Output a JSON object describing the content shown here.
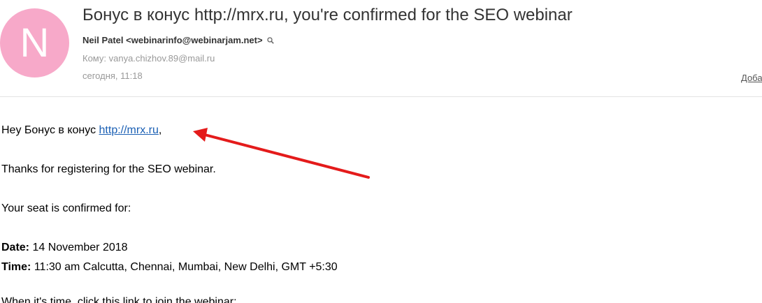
{
  "email": {
    "avatar_letter": "N",
    "avatar_color": "#f7a9c9",
    "subject": "Бонус в конус http://mrx.ru, you're confirmed for the SEO webinar",
    "sender": "Neil Patel <webinarinfo@webinarjam.net>",
    "recipient": "Кому: vanya.chizhov.89@mail.ru",
    "date": "сегодня, 11:18",
    "add_link": "Доба"
  },
  "body": {
    "greeting_prefix": "Hey Бонус в конус ",
    "greeting_link": "http://mrx.ru",
    "greeting_suffix": ",",
    "thanks": "Thanks for registering for the SEO webinar.",
    "seat": "Your seat is confirmed for:",
    "date_label": "Date:",
    "date_value": " 14 November 2018",
    "time_label": "Time:",
    "time_value": " 11:30 am Calcutta, Chennai, Mumbai, New Delhi, GMT +5:30",
    "cut_line": "When it's time, click this link to join the webinar:"
  },
  "annotation": {
    "arrow_color": "#e41b1b"
  }
}
